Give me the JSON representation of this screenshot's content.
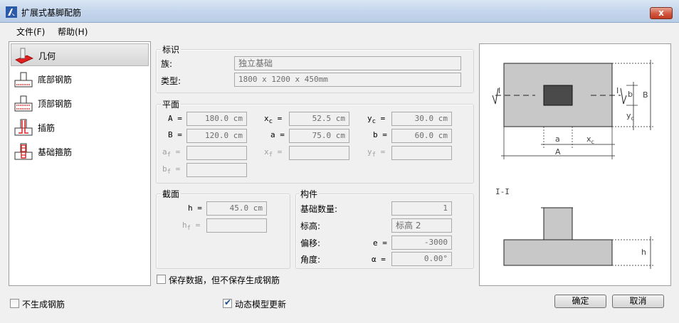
{
  "window": {
    "title": "扩展式基脚配筋",
    "close_label": "x"
  },
  "menu": {
    "file": "文件(F)",
    "help": "帮助(H)"
  },
  "nav": {
    "items": [
      {
        "label": "几何",
        "icon": "geometry-icon"
      },
      {
        "label": "底部钢筋",
        "icon": "bottom-rebar-icon"
      },
      {
        "label": "顶部钢筋",
        "icon": "top-rebar-icon"
      },
      {
        "label": "插筋",
        "icon": "dowel-icon"
      },
      {
        "label": "基础箍筋",
        "icon": "stirrup-icon"
      }
    ]
  },
  "identification": {
    "title": "标识",
    "family_label": "族:",
    "family_value": "独立基础",
    "type_label": "类型:",
    "type_value": "1800 x 1200 x 450mm"
  },
  "plan": {
    "title": "平面",
    "A_label": "A =",
    "A_value": "180.0 cm",
    "xc_label": "x",
    "xc_sub": "c",
    "xc_value": "52.5 cm",
    "yc_label": "y",
    "yc_sub": "c",
    "yc_value": "30.0 cm",
    "B_label": "B =",
    "B_value": "120.0 cm",
    "a_label": "a =",
    "a_value": "75.0 cm",
    "b_label": "b =",
    "b_value": "60.0 cm",
    "af_label": "a",
    "af_sub": "f",
    "xf_label": "x",
    "xf_sub": "f",
    "yf_label": "y",
    "yf_sub": "f",
    "bf_label": "b",
    "bf_sub": "f",
    "eq": "="
  },
  "section": {
    "title": "截面",
    "h_label": "h =",
    "h_value": "45.0 cm",
    "hf_label": "h",
    "hf_sub": "f"
  },
  "component": {
    "title": "构件",
    "count_label": "基础数量:",
    "count_value": "1",
    "elevation_label": "标高:",
    "elevation_value": "标高 2",
    "offset_label": "偏移:",
    "offset_symbol": "e =",
    "offset_value": "-3000",
    "angle_label": "角度:",
    "angle_symbol": "α =",
    "angle_value": "0.00°"
  },
  "save_data_checkbox": {
    "label": "保存数据，但不保存生成钢筋",
    "checked": false
  },
  "no_rebar_checkbox": {
    "label": "不生成钢筋",
    "checked": false
  },
  "dynamic_update_checkbox": {
    "label": "动态模型更新",
    "checked": true
  },
  "buttons": {
    "ok": "确定",
    "cancel": "取消"
  },
  "preview": {
    "section_marker": "I",
    "dim_A": "A",
    "dim_B": "B",
    "dim_a": "a",
    "dim_b": "b",
    "dim_xc": "x",
    "dim_yc": "y",
    "sub_c": "c",
    "section_title": "I-I",
    "dim_h": "h"
  }
}
